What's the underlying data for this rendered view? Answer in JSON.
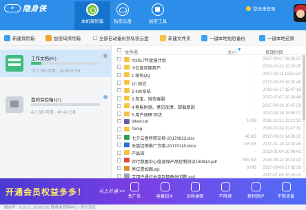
{
  "app": {
    "logo_badge": "e",
    "logo_text": "隐身侠"
  },
  "nav": [
    {
      "label": "本机保险箱",
      "icon": "vault-icon",
      "active": true
    },
    {
      "label": "私密云盘",
      "icon": "cloud-icon",
      "active": false
    },
    {
      "label": "加密工具",
      "icon": "tools-icon",
      "active": false
    }
  ],
  "login": {
    "text": "您还未登录"
  },
  "toolbar": {
    "new_vault": "新建保险箱",
    "add_vault": "加密码保险箱",
    "auto_backup": "全部自动备份到私密云盘",
    "new_folder": "新建文件夹",
    "upload_local": "一键本地加密备份",
    "restore": "一键本地还原"
  },
  "vaults": [
    {
      "name": "工作文档(H:)",
      "usage_text": "75.7 GB 可用，共 88.8 GB",
      "fill": 0.15,
      "selected": true
    },
    {
      "name": "我的保险箱1(I:)",
      "usage_text": "4.0 GB 可用，共 4.0 GB",
      "fill": 0.0,
      "selected": false
    }
  ],
  "filelist": {
    "col_name": "文件名",
    "col_size": "大小",
    "col_date": "修改时间",
    "rows": [
      {
        "name": "!!!2017年度报计划",
        "size": "-",
        "date": "2017-09-07 09:39:27",
        "type": "folder"
      },
      {
        "name": "!!!云盘到期用户",
        "size": "-",
        "date": "2018-10-23 10:20:25",
        "type": "folder"
      },
      {
        "name": "1 荣钩QQ",
        "size": "-",
        "date": "2017-05-11 15:51:24",
        "type": "folder"
      },
      {
        "name": "10 测试",
        "size": "-",
        "date": "2017-08-29 16:32:48",
        "type": "folder"
      },
      {
        "name": "2 400系统",
        "size": "-",
        "date": "2018-05-17 15:47:16",
        "type": "folder"
      },
      {
        "name": "3 淘宝、微信客服",
        "size": "-",
        "date": "2017-07-07 10:38:46",
        "type": "folder"
      },
      {
        "name": "4 客服射源、意见反馈、卸载原因",
        "size": "-",
        "date": "2017-09-18 10:07:58",
        "type": "folder"
      },
      {
        "name": "5 用户调研 回访",
        "size": "-",
        "date": "2017-09-16 15:50:07",
        "type": "folder"
      },
      {
        "name": "bitset.rar",
        "size": "1 MB",
        "date": "2016-12-21 11:22:13",
        "type": "rar"
      },
      {
        "name": "Temp",
        "size": "-",
        "date": "2018-10-24 11:47:19",
        "type": "folder"
      },
      {
        "name": "七夕云盘特惠安排-20170823.xlsx",
        "size": "48 KB",
        "date": "2017-08-23 14:36:20",
        "type": "xlsx"
      },
      {
        "name": "云盘促销推广方案-20170118.docx",
        "size": "716 KB",
        "date": "2017-01-18 12:40:45",
        "type": "docx"
      },
      {
        "name": "产品部",
        "size": "-",
        "date": "2018-01-04 10:06:43",
        "type": "folder"
      },
      {
        "name": "农行数据中心隐身保产品控制协议180814.pdf",
        "size": "545 KB",
        "date": "2018-08-14 16:19:10",
        "type": "pdf"
      },
      {
        "name": "黑位置如图.zip",
        "size": "8 MB",
        "date": "2017-09-08 17:32:28",
        "type": "zip"
      },
      {
        "name": "宝用户通过云盘到期备份问题.xsd",
        "size": "-",
        "date": "2017-07-05 20:20:20",
        "type": "exe"
      }
    ]
  },
  "banner": {
    "title": "开通会员权益多多！",
    "cta": "马上开通 >>",
    "perks": [
      {
        "label": "免广告",
        "icon": "no-ad-icon"
      },
      {
        "label": "容量超大",
        "icon": "storage-icon"
      },
      {
        "label": "远程桌面",
        "icon": "remote-icon"
      },
      {
        "label": "不限速",
        "icon": "speed-icon"
      },
      {
        "label": "复制保护",
        "icon": "shield-icon"
      },
      {
        "label": "不限流量",
        "icon": "traffic-icon"
      }
    ]
  },
  "statusbar": {
    "text": "版本号：6.0.0.2_20180730    隐身侠官网中心 | 官方论坛"
  }
}
